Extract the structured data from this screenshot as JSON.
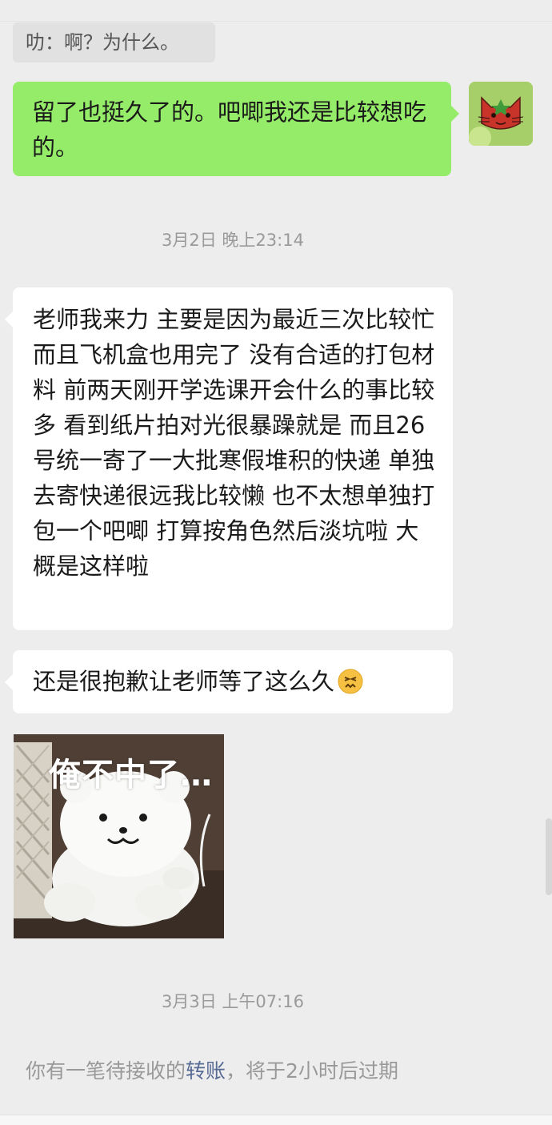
{
  "quote": {
    "text": "叻：啊？为什么。"
  },
  "messages": {
    "m1": {
      "text": "留了也挺久了的。吧唧我还是比较想吃的。",
      "side": "right"
    },
    "m2": {
      "text": "老师我来力 主要是因为最近三次比较忙而且飞机盒也用完了 没有合适的打包材料 前两天刚开学选课开会什么的事比较多 看到纸片拍对光很暴躁就是 而且26号统一寄了一大批寒假堆积的快递 单独去寄快递很远我比较懒 也不太想单独打包一个吧唧 打算按角色然后淡坑啦 大概是这样啦",
      "side": "left"
    },
    "m3": {
      "text": "还是很抱歉让老师等了这么久",
      "side": "left",
      "emoji": "confounded-face-icon"
    }
  },
  "timestamps": {
    "t1": "3月2日 晚上23:14",
    "t2": "3月3日 上午07:16"
  },
  "sticker": {
    "caption": "俺不中了…",
    "subject": "white-bear-plush"
  },
  "system": {
    "before": "你有一笔待接收的",
    "link": "转账",
    "after": "，将于2小时后过期"
  },
  "colors": {
    "self_bubble": "#95ec69",
    "other_bubble": "#ffffff",
    "background": "#ededed",
    "link": "#576b95"
  }
}
